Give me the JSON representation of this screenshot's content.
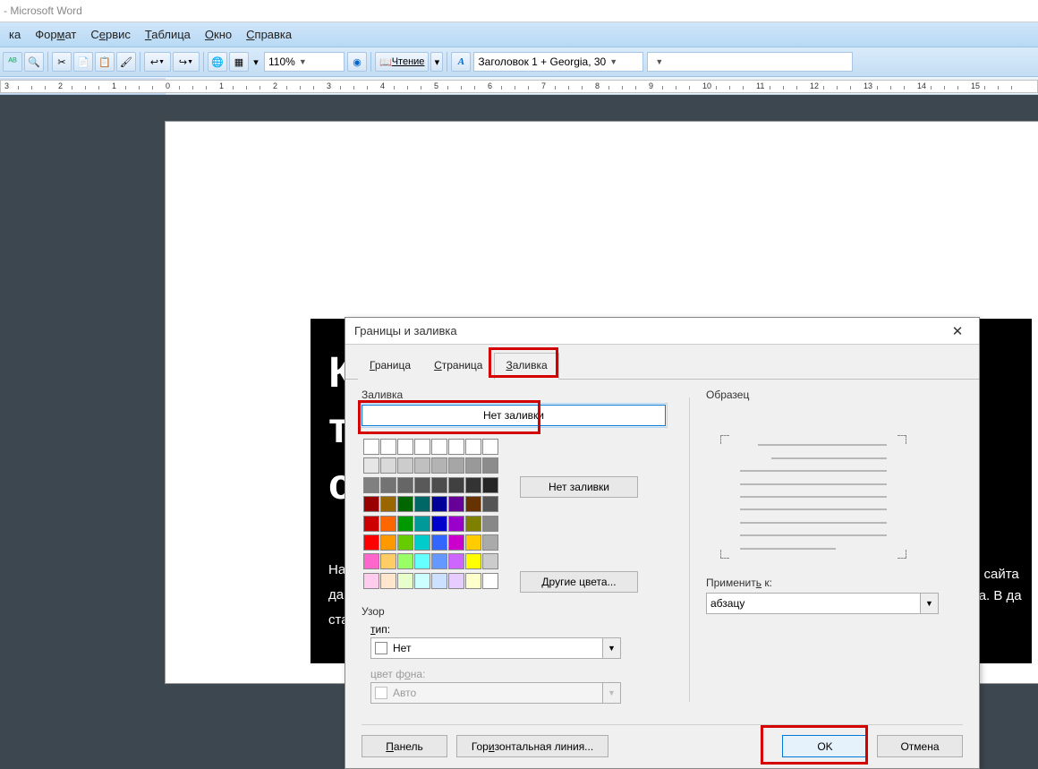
{
  "app": {
    "title_suffix": " - Microsoft Word"
  },
  "menubar": {
    "items": [
      {
        "label": "ка",
        "full": "Вставка"
      },
      {
        "label": "Формат",
        "u": 3
      },
      {
        "label": "Сервис",
        "u": 0
      },
      {
        "label": "Таблица",
        "u": 0
      },
      {
        "label": "Окно",
        "u": 0
      },
      {
        "label": "Справка",
        "u": 0
      }
    ]
  },
  "toolbar": {
    "zoom": "110%",
    "reading_label": "Чтение",
    "style_label": "Заголовок 1 + Georgia, 30"
  },
  "ruler": {
    "start": -3,
    "end": 15
  },
  "document_peek": {
    "big_letters": [
      "К",
      "т",
      "с"
    ],
    "small1": "На",
    "small2": "да",
    "small3": "ста",
    "right1": "о сайта",
    "right2": "та. В да"
  },
  "dialog": {
    "title": "Границы и заливка",
    "tabs": [
      "Граница",
      "Страница",
      "Заливка"
    ],
    "active_tab": 2,
    "fill_section_label": "Заливка",
    "no_fill_label": "Нет заливки",
    "side_no_fill": "Нет заливки",
    "more_colors": "Другие цвета...",
    "pattern_group": "Узор",
    "type_label": "тип:",
    "type_value": "Нет",
    "bgcolor_label": "цвет фона:",
    "bgcolor_value": "Авто",
    "sample_label": "Образец",
    "apply_to_label": "Применить к:",
    "apply_to_value": "абзацу",
    "footer": {
      "panel": "Панель",
      "hline": "Горизонтальная линия...",
      "ok": "OK",
      "cancel": "Отмена"
    },
    "palette_rows": [
      [
        "#ffffff",
        "#ffffff",
        "#ffffff",
        "#ffffff",
        "#ffffff",
        "#ffffff",
        "#ffffff",
        "#ffffff"
      ],
      [
        "#e6e6e6",
        "#d9d9d9",
        "#cccccc",
        "#c0c0c0",
        "#b3b3b3",
        "#a6a6a6",
        "#999999",
        "#8c8c8c"
      ],
      [
        "#808080",
        "#737373",
        "#666666",
        "#595959",
        "#4d4d4d",
        "#404040",
        "#333333",
        "#262626"
      ],
      [
        "#990000",
        "#996600",
        "#006600",
        "#006666",
        "#000099",
        "#660099",
        "#663300",
        "#555555"
      ],
      [
        "#cc0000",
        "#ff6600",
        "#009900",
        "#009999",
        "#0000cc",
        "#9900cc",
        "#808000",
        "#888888"
      ],
      [
        "#ff0000",
        "#ff9900",
        "#66cc00",
        "#00cccc",
        "#3366ff",
        "#cc00cc",
        "#ffcc00",
        "#aaaaaa"
      ],
      [
        "#ff66cc",
        "#ffcc66",
        "#99ff66",
        "#66ffff",
        "#6699ff",
        "#cc66ff",
        "#ffff00",
        "#cccccc"
      ],
      [
        "#ffccee",
        "#ffe6cc",
        "#e6ffcc",
        "#ccffff",
        "#cce0ff",
        "#e6ccff",
        "#ffffcc",
        "#ffffff"
      ]
    ]
  }
}
